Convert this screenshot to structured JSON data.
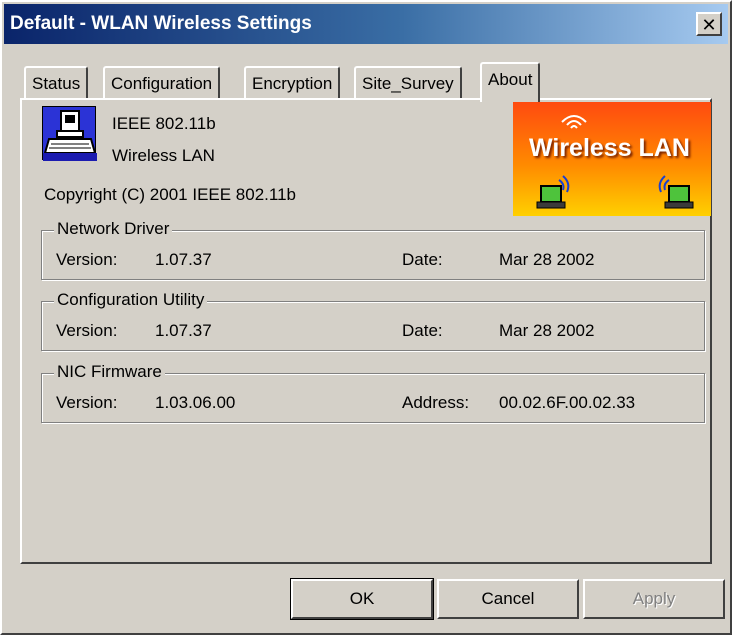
{
  "window": {
    "title": "Default - WLAN Wireless Settings",
    "close_label": "✕"
  },
  "tabs": [
    {
      "label": "Status"
    },
    {
      "label": "Configuration"
    },
    {
      "label": "Encryption"
    },
    {
      "label": "Site_Survey"
    },
    {
      "label": "About",
      "active": true
    }
  ],
  "about": {
    "product_line1": "IEEE 802.11b",
    "product_line2": "Wireless LAN",
    "copyright": "Copyright (C) 2001  IEEE 802.11b",
    "logo_text": "Wireless LAN"
  },
  "groups": [
    {
      "title": "Network Driver",
      "version_label": "Version:",
      "version": "1.07.37",
      "second_label": "Date:",
      "second_value": "Mar 28 2002"
    },
    {
      "title": "Configuration Utility",
      "version_label": "Version:",
      "version": "1.07.37",
      "second_label": "Date:",
      "second_value": "Mar 28 2002"
    },
    {
      "title": "NIC Firmware",
      "version_label": "Version:",
      "version": "1.03.06.00",
      "second_label": "Address:",
      "second_value": "00.02.6F.00.02.33"
    }
  ],
  "buttons": {
    "ok": "OK",
    "cancel": "Cancel",
    "apply": "Apply",
    "apply_enabled": false
  },
  "colors": {
    "titlebar_start": "#0a246a",
    "dialog_face": "#d4d0c8",
    "logo_top": "#ff4a10",
    "logo_bottom": "#ffd000"
  }
}
